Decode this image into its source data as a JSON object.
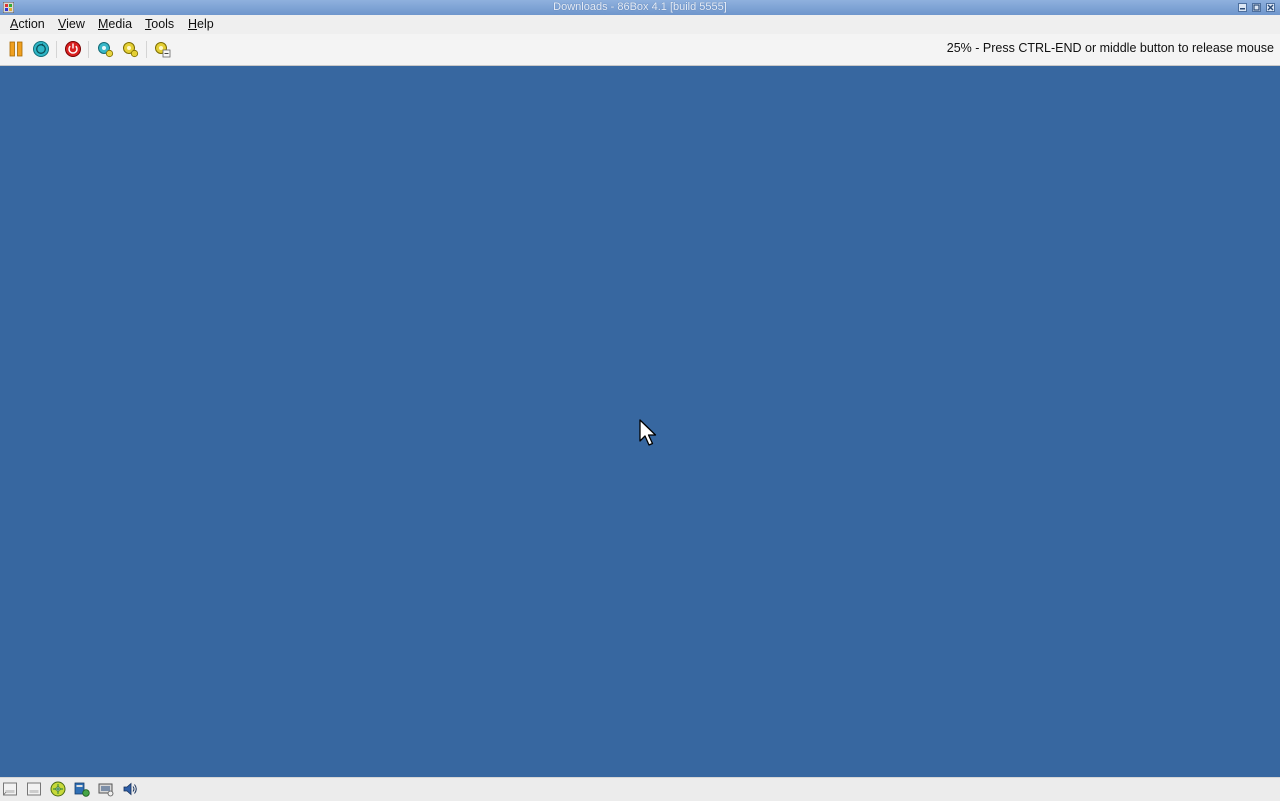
{
  "window": {
    "title": "Downloads - 86Box 4.1 [build 5555]"
  },
  "menubar": {
    "items": [
      {
        "underline": "A",
        "rest": "ction"
      },
      {
        "underline": "V",
        "rest": "iew"
      },
      {
        "underline": "M",
        "rest": "edia"
      },
      {
        "underline": "T",
        "rest": "ools"
      },
      {
        "underline": "H",
        "rest": "elp"
      }
    ]
  },
  "toolbar": {
    "buttons": [
      {
        "name": "pause-icon"
      },
      {
        "name": "ctrl-alt-del-icon"
      },
      {
        "name": "power-icon"
      },
      {
        "name": "hard-reset-icon"
      },
      {
        "name": "settings-icon"
      },
      {
        "name": "machine-config-icon"
      }
    ],
    "status_message": "25% - Press CTRL-END or middle button to release mouse"
  },
  "screen": {
    "background_color": "#3767a0"
  },
  "statusbar": {
    "icons": [
      {
        "name": "floppy-drive-1-icon"
      },
      {
        "name": "floppy-drive-2-icon"
      },
      {
        "name": "cdrom-icon"
      },
      {
        "name": "hard-disk-icon"
      },
      {
        "name": "network-icon"
      },
      {
        "name": "sound-icon"
      }
    ]
  }
}
